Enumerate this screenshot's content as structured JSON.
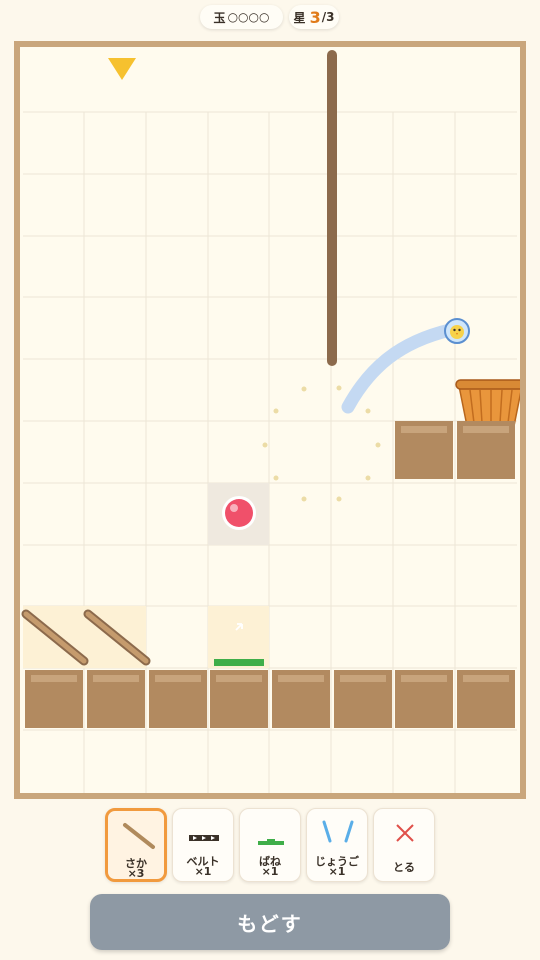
{
  "hud": {
    "balls_label": "玉",
    "balls_marks": "○○○○",
    "stars_label": "星",
    "stars_current": "3",
    "stars_total": "/3"
  },
  "board": {
    "columns": 8,
    "rows": 11,
    "ball_color": "#f0506a",
    "goal": "basket",
    "drop_marker": "yellow-triangle-down",
    "launched_marble_icon": "chick-in-marble"
  },
  "tools": [
    {
      "icon": "slope-icon",
      "name": "さか",
      "count": "×3",
      "selected": true
    },
    {
      "icon": "belt-icon",
      "name": "ベルト",
      "count": "×1",
      "selected": false
    },
    {
      "icon": "spring-icon",
      "name": "ばね",
      "count": "×1",
      "selected": false
    },
    {
      "icon": "funnel-icon",
      "name": "じょうご",
      "count": "×1",
      "selected": false
    },
    {
      "icon": "remove-icon",
      "name": "とる",
      "selected": false
    }
  ],
  "undo_label": "もどす",
  "colors": {
    "frame": "#c9a67c",
    "block": "#b28a60",
    "accent": "#f19a3e",
    "spring": "#3fae49",
    "trajectory": "#c4d9f2"
  }
}
